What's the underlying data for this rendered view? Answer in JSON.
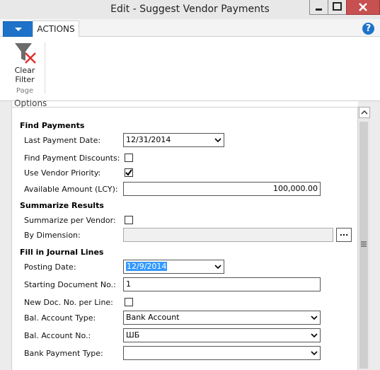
{
  "window": {
    "title": "Edit - Suggest Vendor Payments"
  },
  "ribbon": {
    "tab_actions": "ACTIONS",
    "clear_filter_label": "Clear Filter",
    "group_label": "Page"
  },
  "form": {
    "options_title": "Options",
    "find_payments": {
      "heading": "Find Payments",
      "last_payment_date_label": "Last Payment Date:",
      "last_payment_date_value": "12/31/2014",
      "find_payment_discounts_label": "Find Payment Discounts:",
      "find_payment_discounts_checked": false,
      "use_vendor_priority_label": "Use Vendor Priority:",
      "use_vendor_priority_checked": true,
      "available_amount_label": "Available Amount (LCY):",
      "available_amount_value": "100,000.00"
    },
    "summarize_results": {
      "heading": "Summarize Results",
      "summarize_per_vendor_label": "Summarize per Vendor:",
      "summarize_per_vendor_checked": false,
      "by_dimension_label": "By Dimension:",
      "by_dimension_value": "",
      "by_dimension_button": "..."
    },
    "fill_journal": {
      "heading": "Fill in Journal Lines",
      "posting_date_label": "Posting Date:",
      "posting_date_value": "12/9/2014",
      "starting_doc_label": "Starting Document No.:",
      "starting_doc_value": "1",
      "new_doc_per_line_label": "New Doc. No. per Line:",
      "new_doc_per_line_checked": false,
      "bal_account_type_label": "Bal. Account Type:",
      "bal_account_type_value": "Bank Account",
      "bal_account_no_label": "Bal. Account No.:",
      "bal_account_no_value": "ШБ",
      "bank_payment_type_label": "Bank Payment Type:",
      "bank_payment_type_value": ""
    }
  },
  "icons": {
    "help": "help-icon",
    "clear_filter": "clear-filter-icon",
    "dropdown": "dropdown-icon",
    "checkmark": "checkmark-icon",
    "chevron": "chevron-down-icon"
  },
  "colors": {
    "accent": "#1e73c8",
    "close": "#c75050",
    "selection": "#3399ff"
  }
}
